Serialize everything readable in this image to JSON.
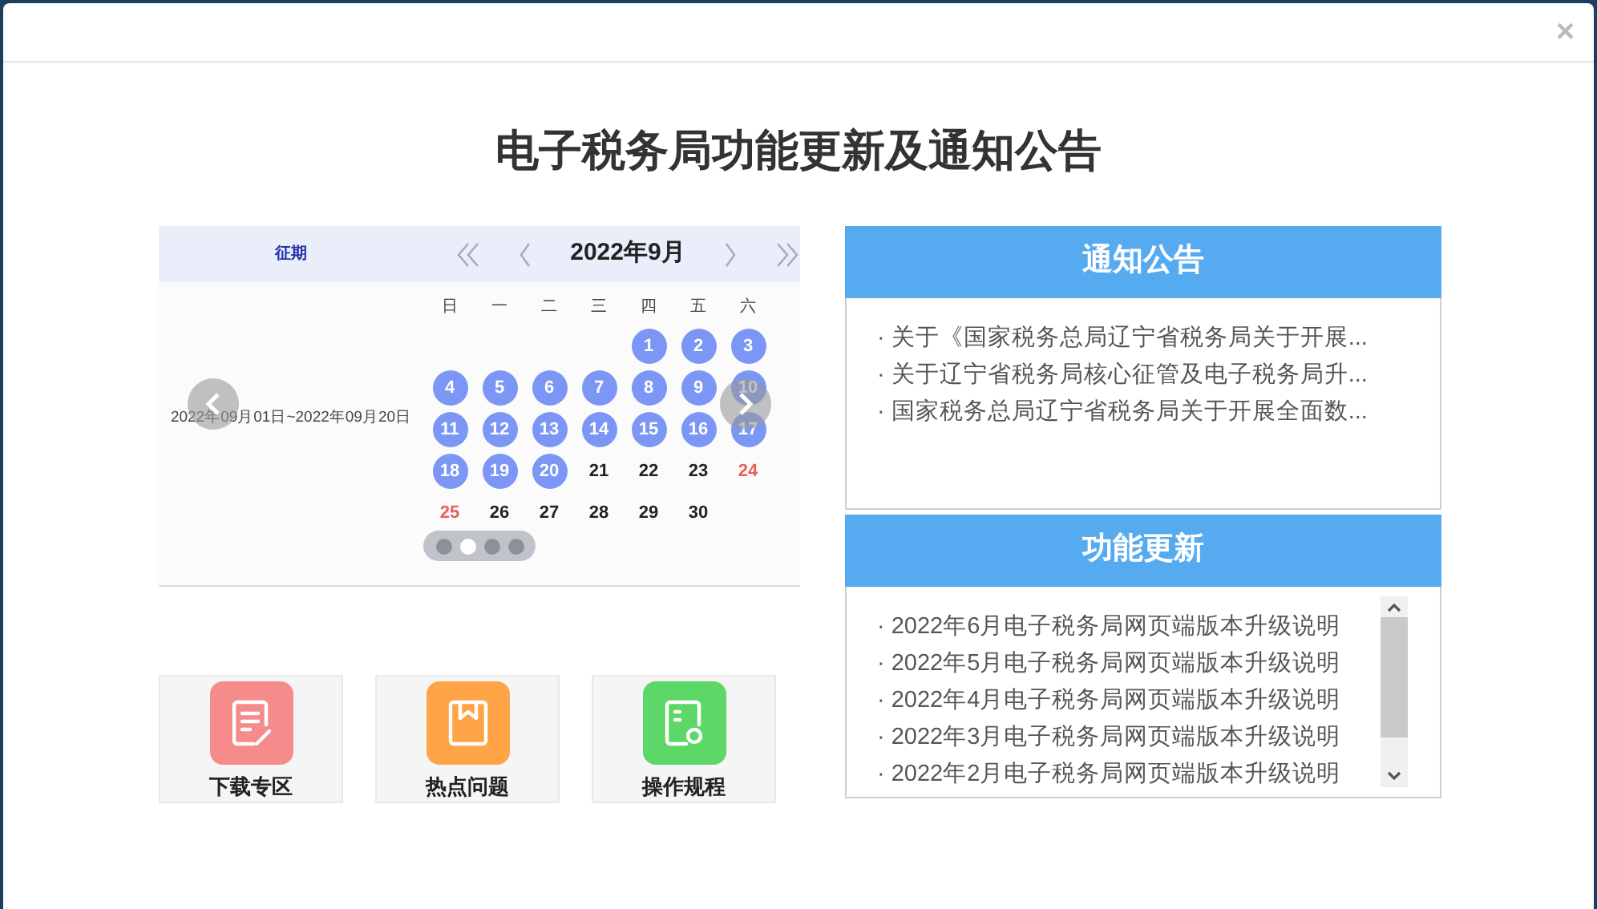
{
  "dialog": {
    "close": "×",
    "title": "电子税务局功能更新及通知公告"
  },
  "calendar": {
    "left_header": "征期",
    "period": "2022年09月01日~2022年09月20日",
    "month": "2022年9月",
    "weekdays": [
      "日",
      "一",
      "二",
      "三",
      "四",
      "五",
      "六"
    ],
    "weeks": [
      [
        {
          "kind": "empty"
        },
        {
          "kind": "empty"
        },
        {
          "kind": "empty"
        },
        {
          "kind": "empty"
        },
        {
          "day": "1",
          "kind": "marked"
        },
        {
          "day": "2",
          "kind": "marked"
        },
        {
          "day": "3",
          "kind": "marked"
        }
      ],
      [
        {
          "day": "4",
          "kind": "marked"
        },
        {
          "day": "5",
          "kind": "marked"
        },
        {
          "day": "6",
          "kind": "marked"
        },
        {
          "day": "7",
          "kind": "marked"
        },
        {
          "day": "8",
          "kind": "marked"
        },
        {
          "day": "9",
          "kind": "marked"
        },
        {
          "day": "10",
          "kind": "marked"
        }
      ],
      [
        {
          "day": "11",
          "kind": "marked"
        },
        {
          "day": "12",
          "kind": "marked"
        },
        {
          "day": "13",
          "kind": "marked"
        },
        {
          "day": "14",
          "kind": "marked"
        },
        {
          "day": "15",
          "kind": "marked"
        },
        {
          "day": "16",
          "kind": "marked"
        },
        {
          "day": "17",
          "kind": "marked"
        }
      ],
      [
        {
          "day": "18",
          "kind": "marked"
        },
        {
          "day": "19",
          "kind": "marked"
        },
        {
          "day": "20",
          "kind": "marked"
        },
        {
          "day": "21",
          "kind": "plain"
        },
        {
          "day": "22",
          "kind": "plain"
        },
        {
          "day": "23",
          "kind": "plain"
        },
        {
          "day": "24",
          "kind": "holiday"
        }
      ],
      [
        {
          "day": "25",
          "kind": "holiday"
        },
        {
          "day": "26",
          "kind": "plain"
        },
        {
          "day": "27",
          "kind": "plain"
        },
        {
          "day": "28",
          "kind": "plain"
        },
        {
          "day": "29",
          "kind": "plain"
        },
        {
          "day": "30",
          "kind": "plain"
        }
      ]
    ],
    "dots": [
      {
        "selected": false
      },
      {
        "selected": true
      },
      {
        "selected": false
      },
      {
        "selected": false
      }
    ]
  },
  "shortcuts": [
    {
      "label": "下载专区",
      "kind": "download"
    },
    {
      "label": "热点问题",
      "kind": "faq"
    },
    {
      "label": "操作规程",
      "kind": "guide"
    }
  ],
  "notices": {
    "title": "通知公告",
    "items": [
      "· 关于《国家税务总局辽宁省税务局关于开展...",
      "· 关于辽宁省税务局核心征管及电子税务局升...",
      "· 国家税务总局辽宁省税务局关于开展全面数..."
    ]
  },
  "updates": {
    "title": "功能更新",
    "items": [
      "· 2022年6月电子税务局网页端版本升级说明",
      "· 2022年5月电子税务局网页端版本升级说明",
      "· 2022年4月电子税务局网页端版本升级说明",
      "· 2022年3月电子税务局网页端版本升级说明",
      "· 2022年2月电子税务局网页端版本升级说明"
    ]
  }
}
